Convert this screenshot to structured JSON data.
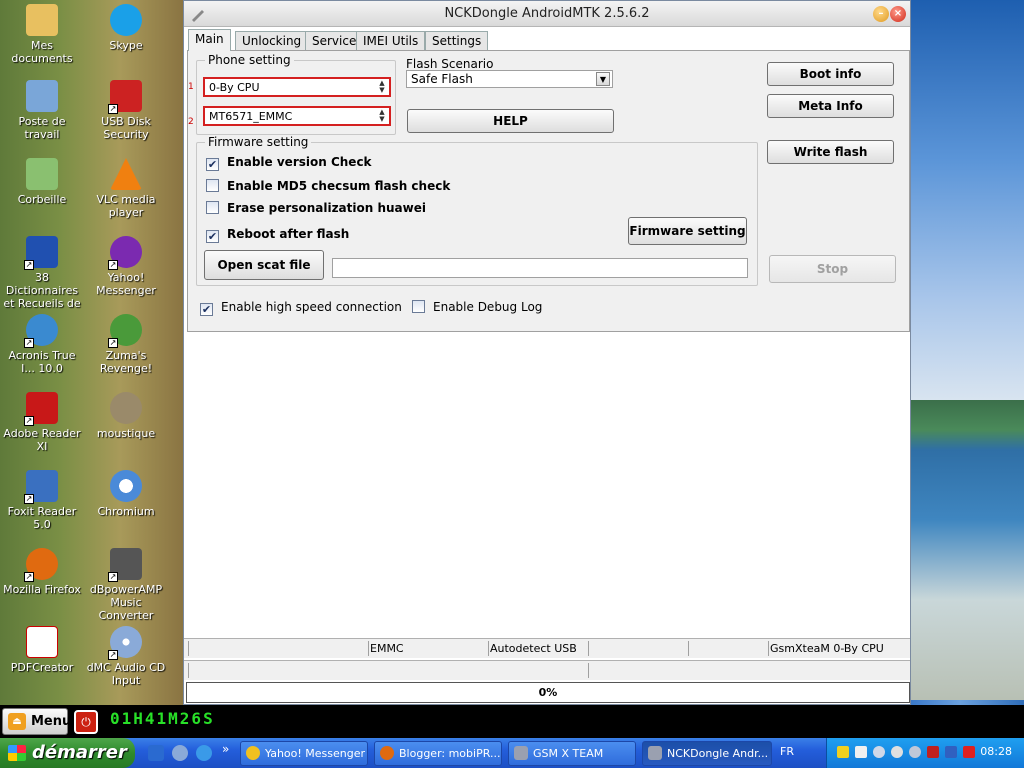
{
  "desktop": {
    "icons": [
      {
        "label": "Mes documents",
        "color": "#e8c060"
      },
      {
        "label": "Skype",
        "color": "#1aa0e8"
      },
      {
        "label": "Poste de travail",
        "color": "#7aa6d8"
      },
      {
        "label": "USB Disk Security",
        "color": "#cc2222"
      },
      {
        "label": "Corbeille",
        "color": "#8ac070"
      },
      {
        "label": "VLC media player",
        "color": "#f08010"
      },
      {
        "label": "38 Dictionnaires et Recueils de ...",
        "color": "#2050b0"
      },
      {
        "label": "Yahoo! Messenger",
        "color": "#7b2ab0"
      },
      {
        "label": "Acronis True I... 10.0",
        "color": "#3a8ad0"
      },
      {
        "label": "Zuma's Revenge!",
        "color": "#4a9a3a"
      },
      {
        "label": "Adobe Reader XI",
        "color": "#c81818"
      },
      {
        "label": "moustique",
        "color": "#9a8a6a"
      },
      {
        "label": "Foxit Reader 5.0",
        "color": "#3a70c0"
      },
      {
        "label": "Chromium",
        "color": "#4a8ad8"
      },
      {
        "label": "Mozilla Firefox",
        "color": "#e06a10"
      },
      {
        "label": "dBpowerAMP Music Converter",
        "color": "#555555"
      },
      {
        "label": "PDFCreator",
        "color": "#ffffff"
      },
      {
        "label": "dMC Audio CD Input",
        "color": "#8aaad8"
      }
    ]
  },
  "window": {
    "title": "NCKDongle AndroidMTK 2.5.6.2",
    "tabs": [
      "Main",
      "Unlocking",
      "Service",
      "IMEI Utils",
      "Settings"
    ],
    "phone_setting": {
      "label": "Phone setting",
      "marker1": "1",
      "marker2": "2",
      "brand": "0-By CPU",
      "cpu": "MT6571_EMMC"
    },
    "flash_scenario": {
      "label": "Flash Scenario",
      "value": "Safe Flash"
    },
    "help_label": "HELP",
    "firmware": {
      "label": "Firmware setting",
      "checks": [
        {
          "label": "Enable version Check",
          "checked": true
        },
        {
          "label": "Enable MD5 checsum flash check",
          "checked": false
        },
        {
          "label": "Erase personalization huawei",
          "checked": false
        },
        {
          "label": "Reboot after flash",
          "checked": true
        }
      ],
      "firmware_btn": "Firmware setting",
      "open_scat": "Open scat file",
      "scat_path": ""
    },
    "right_buttons": {
      "boot_info": "Boot info",
      "meta_info": "Meta Info",
      "write_flash": "Write flash",
      "stop": "Stop"
    },
    "bottom_checks": [
      {
        "label": "Enable high speed connection",
        "checked": true
      },
      {
        "label": "Enable Debug Log",
        "checked": false
      }
    ],
    "status": {
      "storage": "EMMC",
      "usb": "Autodetect USB",
      "team": "GsmXteaM 0-By CPU"
    },
    "progress": "0%"
  },
  "dock": {
    "menu_label": "Menu",
    "timer": "01H41M26S"
  },
  "taskbar": {
    "start_label": "démarrer",
    "more": "»",
    "tasks": [
      {
        "label": "Yahoo! Messenger",
        "color": "#f0c020"
      },
      {
        "label": "Blogger: mobiPR...",
        "color": "#e06a10"
      },
      {
        "label": "GSM X TEAM",
        "color": "#9aa0b0"
      },
      {
        "label": "NCKDongle Andr...",
        "color": "#9aa0b0"
      }
    ],
    "lang": "FR",
    "clock": "08:28"
  },
  "colors": {
    "accent_red": "#d42020",
    "check_mark": "#1b3060"
  }
}
